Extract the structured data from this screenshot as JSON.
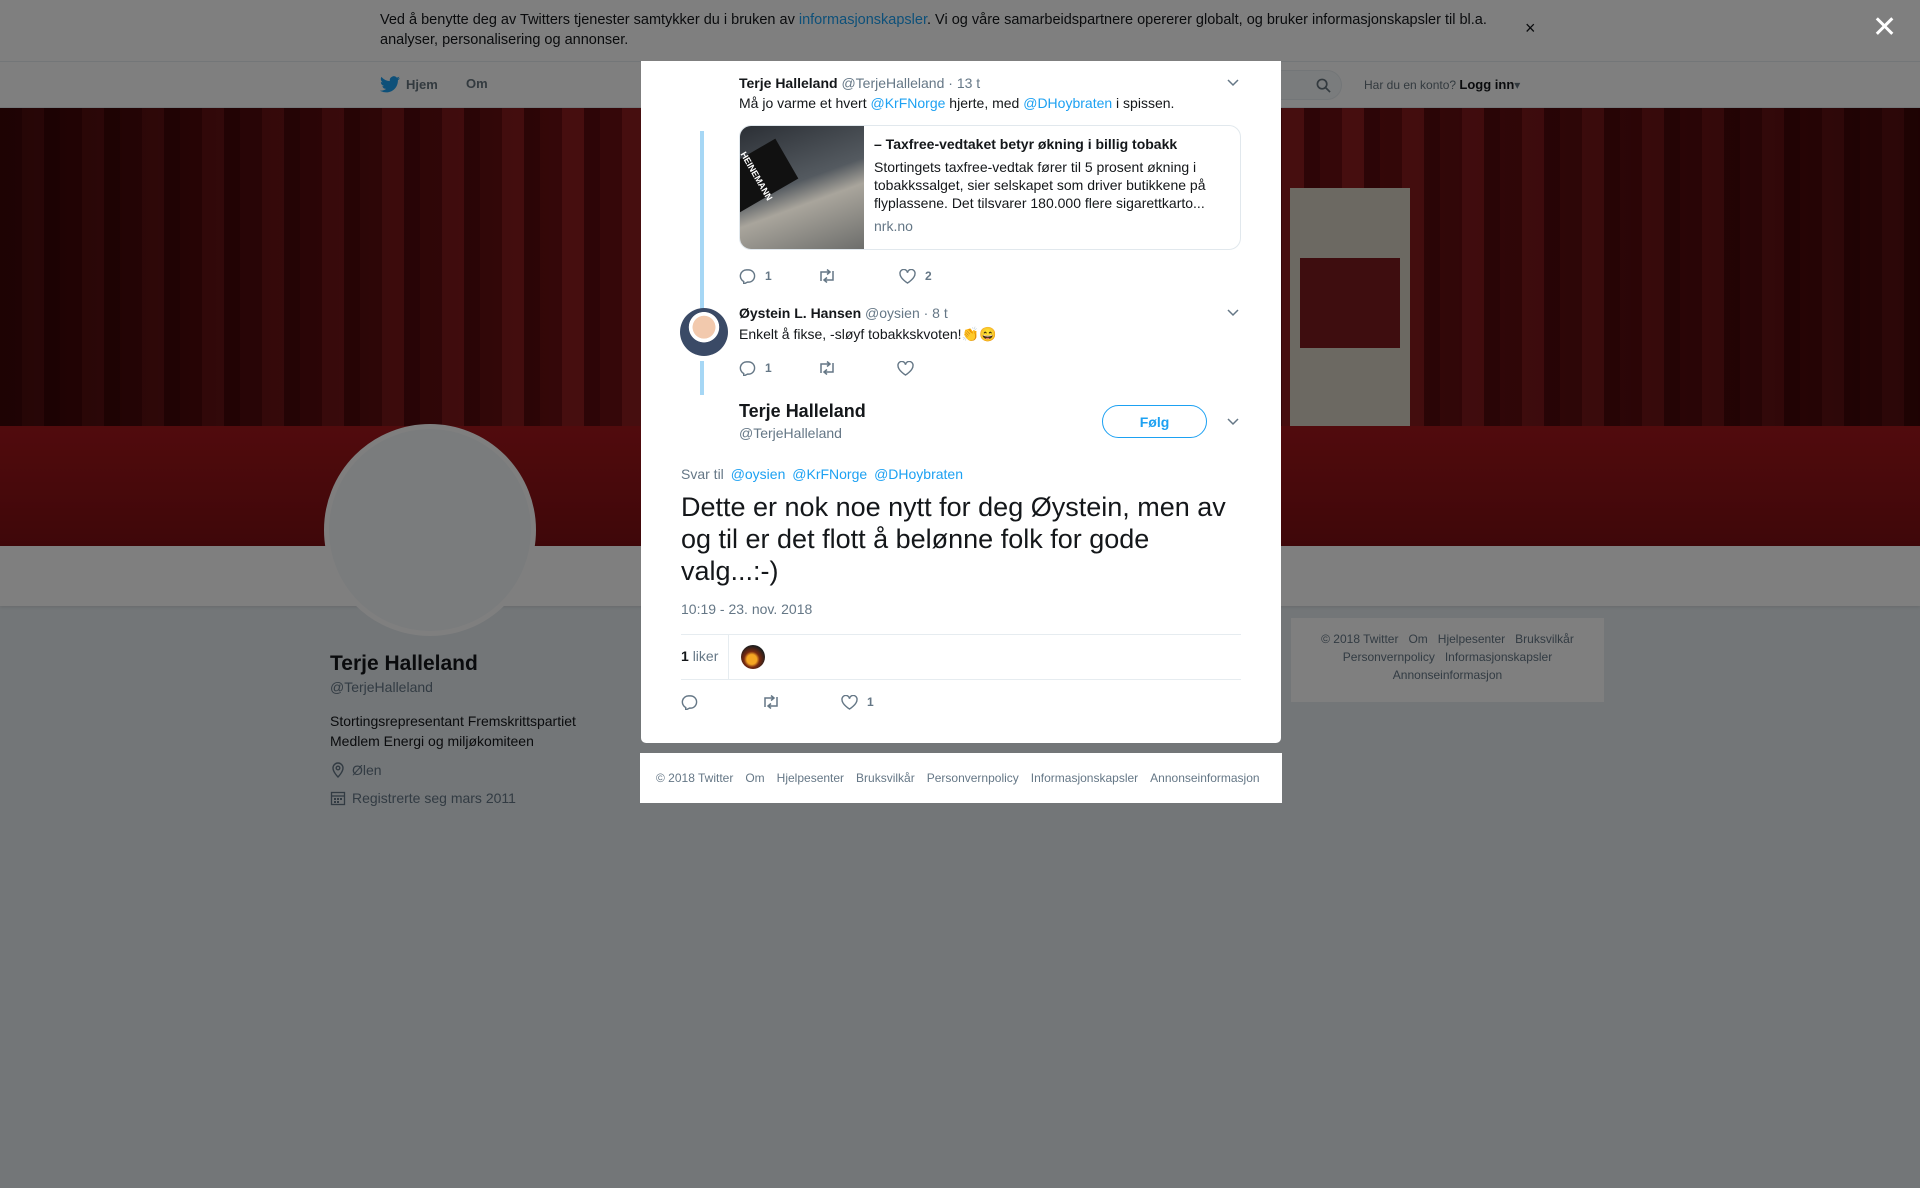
{
  "cookie": {
    "text_before": "Ved å benytte deg av Twitters tjenester samtykker du i bruken av ",
    "link": "informasjonskapsler",
    "text_after": ". Vi og våre samarbeidspartnere opererer globalt, og bruker informasjonskapsler til bl.a. analyser, personalisering og annonser.",
    "close": "×"
  },
  "nav": {
    "home": "Hjem",
    "about": "Om",
    "login_question": "Har du en konto?",
    "login": "Logg inn"
  },
  "profile": {
    "name": "Terje Halleland",
    "handle": "@TerjeHalleland",
    "bio_line1": "Stortingsrepresentant Fremskrittspartiet",
    "bio_line2": "Medlem Energi og miljøkomiteen",
    "location": "Ølen",
    "joined": "Registrerte seg mars 2011"
  },
  "side_footer": {
    "items": [
      "© 2018 Twitter",
      "Om",
      "Hjelpesenter",
      "Bruksvilkår",
      "Personvernpolicy",
      "Informasjonskapsler",
      "Annonseinformasjon"
    ]
  },
  "overlay_close": "✕",
  "thread": {
    "tweet1": {
      "name": "Terje Halleland",
      "handle": "@TerjeHalleland",
      "time": "· 13 t",
      "text_a": "Må jo varme et hvert ",
      "mention1": "@KrFNorge",
      "text_b": " hjerte, med ",
      "mention2": "@DHoybraten",
      "text_c": " i spissen.",
      "card": {
        "image_sign": "HEINEMANN",
        "title": "– Taxfree-vedtaket betyr økning i billig tobakk",
        "description": "Stortingets taxfree-vedtak fører til 5 prosent økning i tobakkssalget, sier selskapet som driver butikkene på flyplassene. Det tilsvarer 180.000 flere sigarettkarto...",
        "domain": "nrk.no"
      },
      "replies": "1",
      "retweets": "",
      "likes": "2"
    },
    "tweet2": {
      "name": "Øystein L. Hansen",
      "handle": "@oysien",
      "time": "· 8 t",
      "text": "Enkelt å fikse, -sløyf tobakkskvoten!👏😄",
      "replies": "1",
      "retweets": "",
      "likes": ""
    }
  },
  "main_tweet": {
    "name": "Terje Halleland",
    "handle": "@TerjeHalleland",
    "follow": "Følg",
    "reply_label": "Svar til",
    "reply_mentions": [
      "@oysien",
      "@KrFNorge",
      "@DHoybraten"
    ],
    "text": "Dette er nok noe nytt for deg Øystein, men av og til er det flott å belønne folk for gode valg...:-)",
    "timestamp": "10:19 - 23. nov. 2018",
    "likes_count": "1",
    "likes_label": "liker",
    "action_likes": "1"
  },
  "modal_footer": {
    "items": [
      "© 2018 Twitter",
      "Om",
      "Hjelpesenter",
      "Bruksvilkår",
      "Personvernpolicy",
      "Informasjonskapsler",
      "Annonseinformasjon"
    ]
  },
  "colors": {
    "accent": "#1da1f2",
    "muted": "#657786",
    "overlay": "rgba(0,0,0,0.5)",
    "banner_red": "#8d1c1f"
  }
}
